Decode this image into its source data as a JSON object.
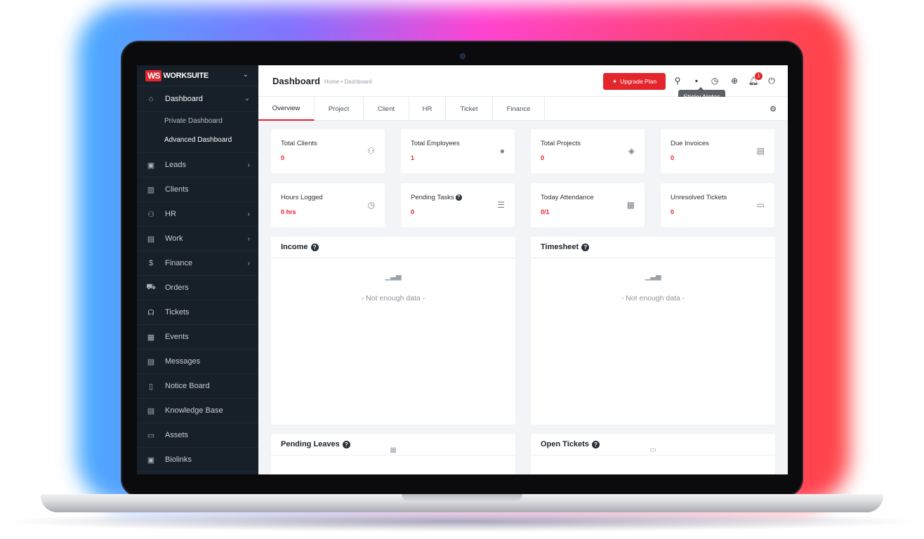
{
  "sidebar": {
    "logo_mark": "WS",
    "logo_text": "WORKSUITE",
    "dashboard": {
      "label": "Dashboard",
      "sub": [
        "Private Dashboard",
        "Advanced Dashboard"
      ]
    },
    "items": [
      {
        "label": "Leads",
        "icon": "contact-card-icon",
        "has_arrow": true
      },
      {
        "label": "Clients",
        "icon": "building-icon",
        "has_arrow": false
      },
      {
        "label": "HR",
        "icon": "people-icon",
        "has_arrow": true
      },
      {
        "label": "Work",
        "icon": "briefcase-icon",
        "has_arrow": true
      },
      {
        "label": "Finance",
        "icon": "dollar-icon",
        "has_arrow": true
      },
      {
        "label": "Orders",
        "icon": "cart-icon",
        "has_arrow": false
      },
      {
        "label": "Tickets",
        "icon": "headset-icon",
        "has_arrow": false
      },
      {
        "label": "Events",
        "icon": "calendar-icon",
        "has_arrow": false
      },
      {
        "label": "Messages",
        "icon": "chat-icon",
        "has_arrow": false
      },
      {
        "label": "Notice Board",
        "icon": "clipboard-icon",
        "has_arrow": false
      },
      {
        "label": "Knowledge Base",
        "icon": "document-icon",
        "has_arrow": false
      },
      {
        "label": "Assets",
        "icon": "monitor-icon",
        "has_arrow": false
      },
      {
        "label": "Biolinks",
        "icon": "badge-icon",
        "has_arrow": false
      }
    ]
  },
  "header": {
    "title": "Dashboard",
    "breadcrumb": "Home • Dashboard",
    "upgrade_label": "Upgrade Plan",
    "notification_count": "1",
    "tooltip": "Sticky Notes"
  },
  "tabs": [
    "Overview",
    "Project",
    "Client",
    "HR",
    "Ticket",
    "Finance"
  ],
  "stats": [
    {
      "title": "Total Clients",
      "value": "0",
      "icon": "users-icon",
      "help": false
    },
    {
      "title": "Total Employees",
      "value": "1",
      "icon": "user-icon",
      "help": false
    },
    {
      "title": "Total Projects",
      "value": "0",
      "icon": "layers-icon",
      "help": false
    },
    {
      "title": "Due Invoices",
      "value": "0",
      "icon": "file-icon",
      "help": false
    },
    {
      "title": "Hours Logged",
      "value": "0 hrs",
      "icon": "clock-icon",
      "help": false
    },
    {
      "title": "Pending Tasks",
      "value": "0",
      "icon": "tasks-icon",
      "help": true
    },
    {
      "title": "Today Attendance",
      "value": "0/1",
      "icon": "calendar-check-icon",
      "help": false
    },
    {
      "title": "Unresolved Tickets",
      "value": "0",
      "icon": "ticket-icon",
      "help": false
    }
  ],
  "panels": {
    "income": {
      "title": "Income",
      "empty": "- Not enough data -"
    },
    "timesheet": {
      "title": "Timesheet",
      "empty": "- Not enough data -"
    },
    "pending_leaves": {
      "title": "Pending Leaves"
    },
    "open_tickets": {
      "title": "Open Tickets"
    }
  },
  "colors": {
    "accent": "#e3262c",
    "sidebar": "#171f29"
  }
}
